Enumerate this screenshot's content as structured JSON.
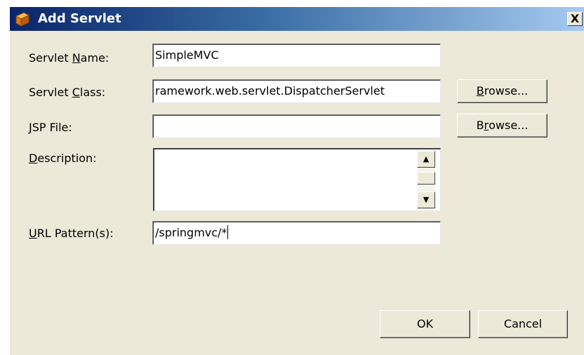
{
  "window": {
    "title": "Add Servlet",
    "close_label": "X"
  },
  "form": {
    "servlet_name": {
      "label_pre": "Servlet ",
      "label_mnemonic": "N",
      "label_post": "ame:",
      "value": "SimpleMVC"
    },
    "servlet_class": {
      "label_pre": "Servlet ",
      "label_mnemonic": "C",
      "label_post": "lass:",
      "value": "ramework.web.servlet.DispatcherServlet"
    },
    "jsp_file": {
      "label_pre": "",
      "label_mnemonic": "J",
      "label_post": "SP File:",
      "value": ""
    },
    "description": {
      "label_pre": "",
      "label_mnemonic": "D",
      "label_post": "escription:",
      "value": ""
    },
    "url_pattern": {
      "label_pre": "",
      "label_mnemonic": "U",
      "label_post": "RL Pattern(s):",
      "value": "/springmvc/*"
    }
  },
  "buttons": {
    "browse_class": {
      "pre": "",
      "mnemonic": "B",
      "post": "rowse..."
    },
    "browse_jsp": {
      "pre": "B",
      "mnemonic": "r",
      "post": "owse..."
    },
    "ok": "OK",
    "cancel": "Cancel"
  },
  "colors": {
    "titlebar_start": "#0a246a",
    "titlebar_end": "#a6caf0",
    "dialog_bg": "#ece9d8"
  },
  "icons": {
    "title": "folder-box-icon",
    "close": "close-icon",
    "scroll_up": "arrow-up-icon",
    "scroll_down": "arrow-down-icon"
  }
}
